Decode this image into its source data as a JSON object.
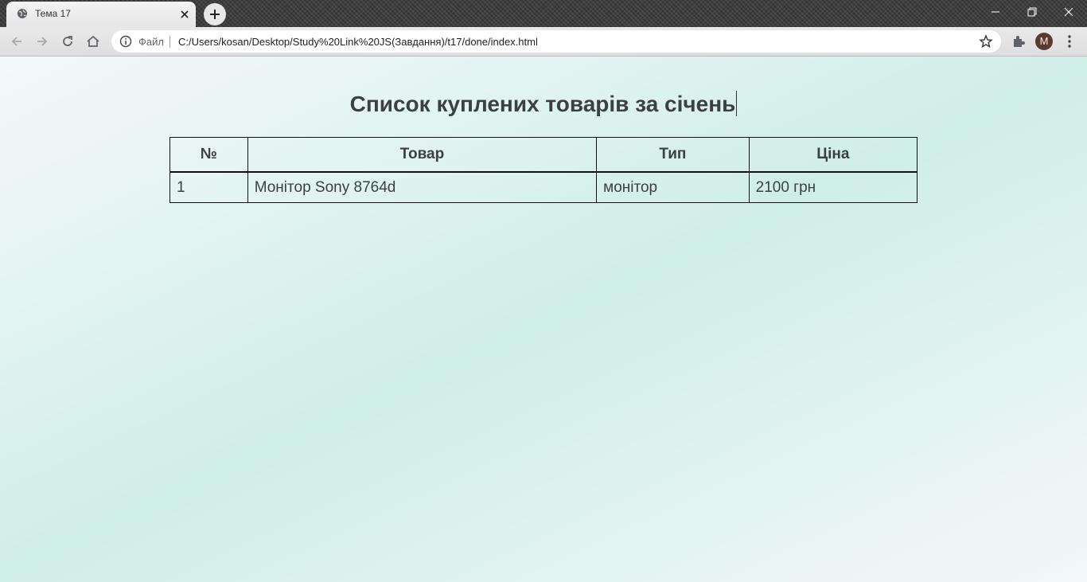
{
  "browser": {
    "tab": {
      "title": "Тема 17",
      "favicon": "globe-icon"
    },
    "address_bar": {
      "scheme_label": "Файл",
      "url": "C:/Users/kosan/Desktop/Study%20Link%20JS(Завдання)/t17/done/index.html"
    },
    "profile_initial": "M",
    "colors": {
      "avatar": "#5b3a2e",
      "tab_bg": "#f3f3f3",
      "toolbar_bg": "#e4e4e4"
    }
  },
  "page": {
    "title": "Список куплених товарів за січень",
    "table": {
      "headers": [
        "№",
        "Товар",
        "Тип",
        "Ціна"
      ],
      "rows": [
        [
          "1",
          "Монітор Sony 8764d",
          "монітор",
          "2100 грн"
        ]
      ]
    },
    "colors": {
      "text": "#3b4142",
      "border": "#111111",
      "bg_mint": "#cfeee6"
    }
  }
}
